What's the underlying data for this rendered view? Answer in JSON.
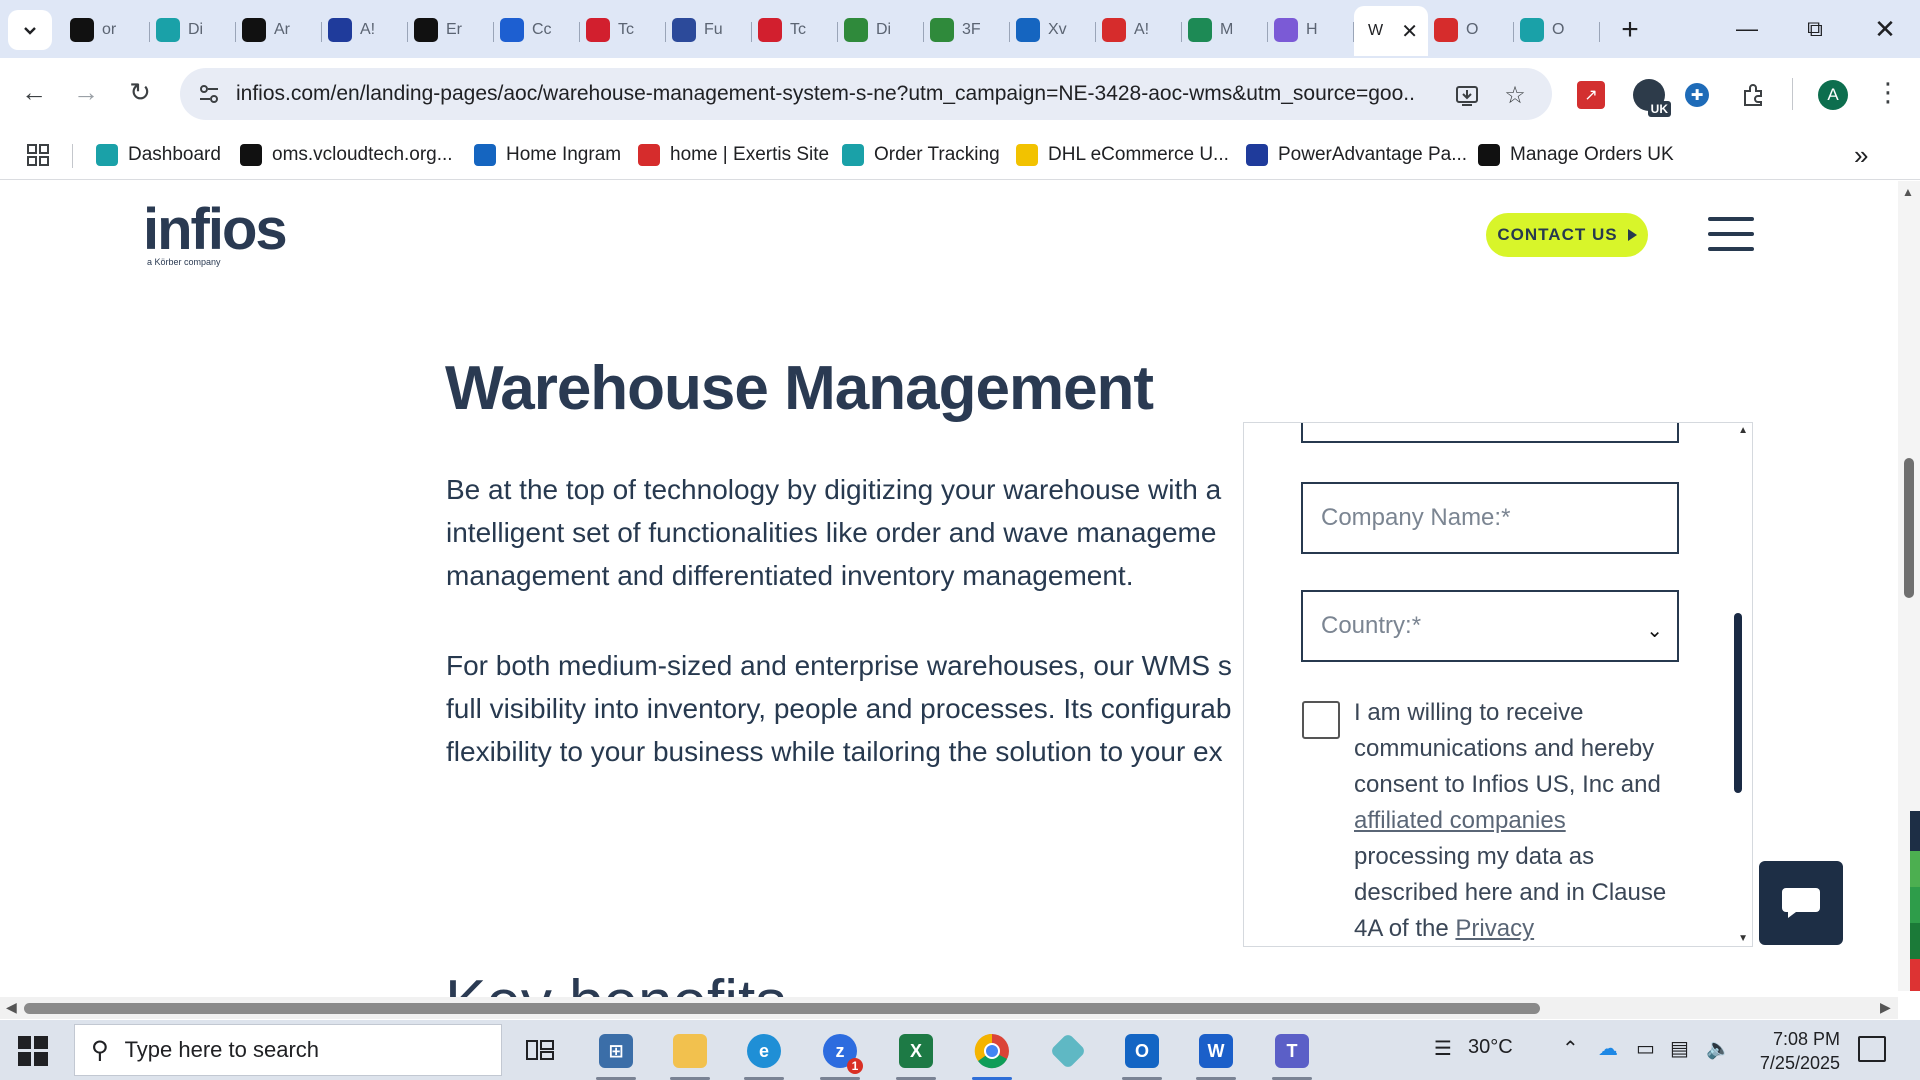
{
  "browser": {
    "tabs": [
      {
        "label": "or",
        "icon": "circle-a-icon",
        "color": "#111111"
      },
      {
        "label": "Di",
        "icon": "hexagon-icon",
        "color": "#1aa1a8"
      },
      {
        "label": "Ar",
        "icon": "amazon-icon",
        "color": "#111111"
      },
      {
        "label": "A!",
        "icon": "arrow-icon",
        "color": "#1f3b9b"
      },
      {
        "label": "Er",
        "icon": "openai-icon",
        "color": "#111111"
      },
      {
        "label": "Cc",
        "icon": "c-icon",
        "color": "#1d5fd1"
      },
      {
        "label": "Tc",
        "icon": "c-icon",
        "color": "#d21f2e"
      },
      {
        "label": "Fu",
        "icon": "box-icon",
        "color": "#2c4a9a"
      },
      {
        "label": "Tc",
        "icon": "c-icon",
        "color": "#d21f2e"
      },
      {
        "label": "Di",
        "icon": "sheet-icon",
        "color": "#2f8a3b"
      },
      {
        "label": "3F",
        "icon": "sheet-icon",
        "color": "#2f8a3b"
      },
      {
        "label": "Xv",
        "icon": "x-icon",
        "color": "#1565c0"
      },
      {
        "label": "A!",
        "icon": "e-icon",
        "color": "#d62c2c"
      },
      {
        "label": "M",
        "icon": "leaf-icon",
        "color": "#1d8a55"
      },
      {
        "label": "H",
        "icon": "chart-icon",
        "color": "#7b5ad6"
      },
      {
        "label": "W",
        "icon": "",
        "color": "#ffffff",
        "active": true
      },
      {
        "label": "O",
        "icon": "shop-icon",
        "color": "#d62c2c"
      },
      {
        "label": "O",
        "icon": "c-icon",
        "color": "#1aa1a8"
      }
    ],
    "url_domain": "infios.com",
    "url_path": "/en/landing-pages/aoc/warehouse-management-system-s-ne?utm_campaign=NE-3428-aoc-wms&utm_source=goo...",
    "profile_initial": "A",
    "ext_badge": "UK",
    "bookmarks": [
      {
        "label": "Dashboard",
        "icon": "hexagon-icon",
        "color": "#1aa1a8"
      },
      {
        "label": "oms.vcloudtech.org...",
        "icon": "circle-a-icon",
        "color": "#111111"
      },
      {
        "label": "Home Ingram",
        "icon": "ingram-icon",
        "color": "#1565c0"
      },
      {
        "label": "home | Exertis Site",
        "icon": "e-icon",
        "color": "#d62c2c"
      },
      {
        "label": "Order Tracking",
        "icon": "c-icon",
        "color": "#1aa1a8"
      },
      {
        "label": "DHL eCommerce U...",
        "icon": "dhl-icon",
        "color": "#f2c200"
      },
      {
        "label": "PowerAdvantage Pa...",
        "icon": "f-icon",
        "color": "#1f3b9b"
      },
      {
        "label": "Manage Orders UK",
        "icon": "amazon-icon",
        "color": "#111111"
      }
    ]
  },
  "page": {
    "logo_text": "infios",
    "logo_sub": "a Körber company",
    "contact_label": "CONTACT US",
    "headline": "Warehouse Management",
    "para1": [
      "Be at the top of technology by digitizing your warehouse with a",
      "intelligent set of functionalities like order and wave manageme",
      "management and differentiated inventory management."
    ],
    "para2": [
      "For both medium-sized and enterprise warehouses, our WMS s",
      "full visibility into inventory, people and processes. Its configurab",
      "flexibility to your business while tailoring the solution to your ex"
    ],
    "section_heading": "Key benefits",
    "form": {
      "company_placeholder": "Company Name:*",
      "country_placeholder": "Country:*",
      "consent_1": "I am willing to receive communications and hereby consent to Infios US, Inc and",
      "consent_link": "affiliated companies",
      "consent_2": "processing my data as described here and in Clause 4A of the",
      "privacy_link": "Privacy"
    }
  },
  "taskbar": {
    "search_placeholder": "Type here to search",
    "temperature": "30°C",
    "time": "7:08 PM",
    "date": "7/25/2025",
    "zoom_badge": "1"
  }
}
